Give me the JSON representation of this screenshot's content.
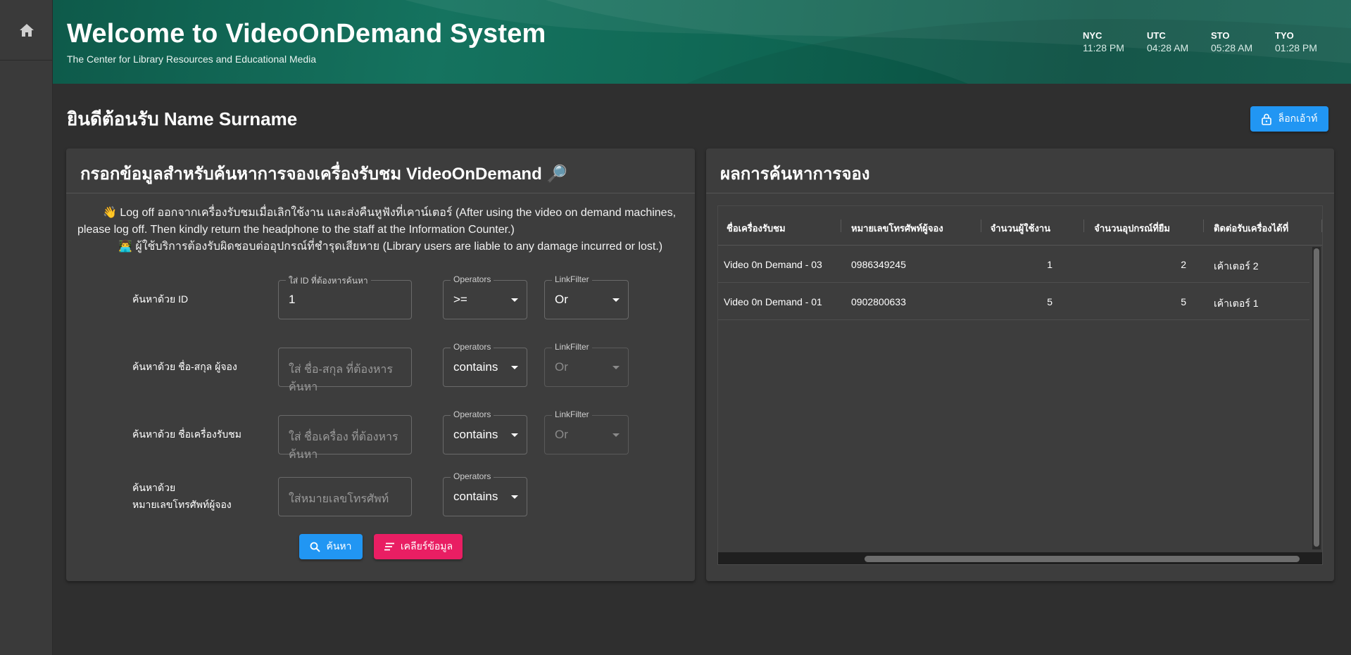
{
  "header": {
    "title": "Welcome to VideoOnDemand System",
    "subtitle": "The Center for Library Resources and Educational Media",
    "clocks": [
      {
        "city": "NYC",
        "time": "11:28 PM"
      },
      {
        "city": "UTC",
        "time": "04:28 AM"
      },
      {
        "city": "STO",
        "time": "05:28 AM"
      },
      {
        "city": "TYO",
        "time": "01:28 PM"
      }
    ]
  },
  "welcome": "ยินดีต้อนรับ Name Surname",
  "logout_label": "ล็อกเอ้าท์",
  "search_card": {
    "title": "กรอกข้อมูลสำหรับค้นหาการจองเครื่องรับชม VideoOnDemand 🔎",
    "notice_1": "👋 Log off ออกจากเครื่องรับชมเมื่อเลิกใช้งาน และส่งคืนหูฟังที่เคาน์เตอร์ (After using the video on demand machines, please log off. Then kindly return the headphone to the staff at the Information Counter.)",
    "notice_2": "👨‍💻 ผู้ใช้บริการต้องรับผิดชอบต่ออุปกรณ์ที่ชำรุดเสียหาย (Library users are liable to any damage incurred or lost.)",
    "rows": [
      {
        "label": "ค้นหาด้วย ID",
        "input_legend": "ใส่ ID ที่ต้องหารค้นหา",
        "input_value": "1",
        "input_placeholder": "",
        "op_legend": "Operators",
        "op_value": ">=",
        "link_legend": "LinkFilter",
        "link_value": "Or"
      },
      {
        "label": "ค้นหาด้วย ชื่อ-สกุล ผู้จอง",
        "input_legend": "",
        "input_value": "",
        "input_placeholder": "ใส่ ชื่อ-สกุล ที่ต้องหารค้นหา",
        "op_legend": "Operators",
        "op_value": "contains",
        "link_legend": "LinkFilter",
        "link_value": "Or"
      },
      {
        "label": "ค้นหาด้วย ชื่อเครื่องรับชม",
        "input_legend": "",
        "input_value": "",
        "input_placeholder": "ใส่ ชื่อเครื่อง ที่ต้องหารค้นหา",
        "op_legend": "Operators",
        "op_value": "contains",
        "link_legend": "LinkFilter",
        "link_value": "Or"
      },
      {
        "label_line1": "ค้นหาด้วย",
        "label_line2": "หมายเลขโทรศัพท์ผู้จอง",
        "input_legend": "",
        "input_value": "",
        "input_placeholder": "ใส่หมายเลขโทรศัพท์",
        "op_legend": "Operators",
        "op_value": "contains"
      }
    ],
    "search_button": "ค้นหา",
    "clear_button": "เคลียร์ข้อมูล"
  },
  "results_card": {
    "title": "ผลการค้นหาการจอง",
    "columns": [
      "ชื่อเครื่องรับชม",
      "หมายเลขโทรศัพท์ผู้จอง",
      "จำนวนผู้ใช้งาน",
      "จำนวนอุปกรณ์ที่ยืม",
      "ติดต่อรับเครื่องได้ที่"
    ],
    "rows": [
      {
        "machine": "Video 0n Demand - 03",
        "phone": "0986349245",
        "users": "1",
        "devices": "2",
        "counter": "เค้าเตอร์ 2"
      },
      {
        "machine": "Video 0n Demand - 01",
        "phone": "0902800633",
        "users": "5",
        "devices": "5",
        "counter": "เค้าเตอร์ 1"
      }
    ]
  },
  "colors": {
    "primary": "#2196f3",
    "danger": "#e91e63",
    "header": "#15735f",
    "background": "#2f2f2f",
    "card": "#3d3d3d"
  },
  "icons": [
    "home-icon",
    "lock-icon",
    "search-icon",
    "clear-icon"
  ]
}
